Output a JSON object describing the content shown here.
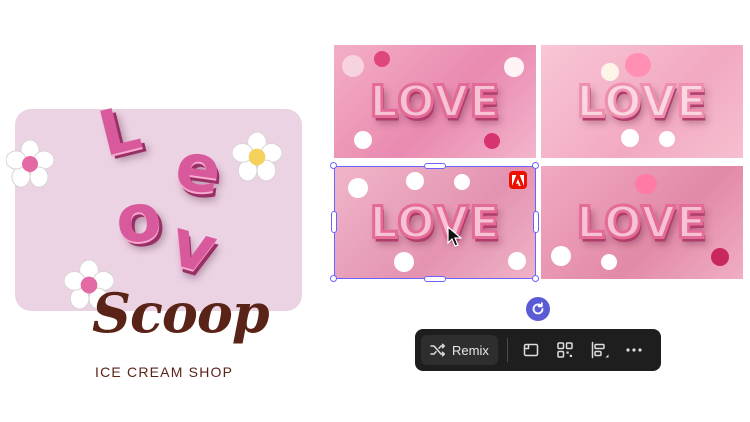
{
  "logo": {
    "letters": [
      "L",
      "e",
      "o",
      "v"
    ],
    "brand_name": "Scoop",
    "tagline": "ICE CREAM SHOP"
  },
  "gallery": {
    "tiles": [
      {
        "text": "LOVE"
      },
      {
        "text": "LOVE"
      },
      {
        "text": "LOVE",
        "selected": true
      },
      {
        "text": "LOVE"
      }
    ],
    "badge_icon": "adobe-icon"
  },
  "toolbar": {
    "remix_label": "Remix",
    "icons": [
      "shuffle-icon",
      "crop-icon",
      "qr-grid-icon",
      "align-icon",
      "more-icon"
    ]
  },
  "colors": {
    "accent": "#5b5bd6",
    "selection": "#6c63ff",
    "toolbar_bg": "#1e1e1e",
    "brand_brown": "#5a2318",
    "card_pink": "#ecd3e4"
  }
}
